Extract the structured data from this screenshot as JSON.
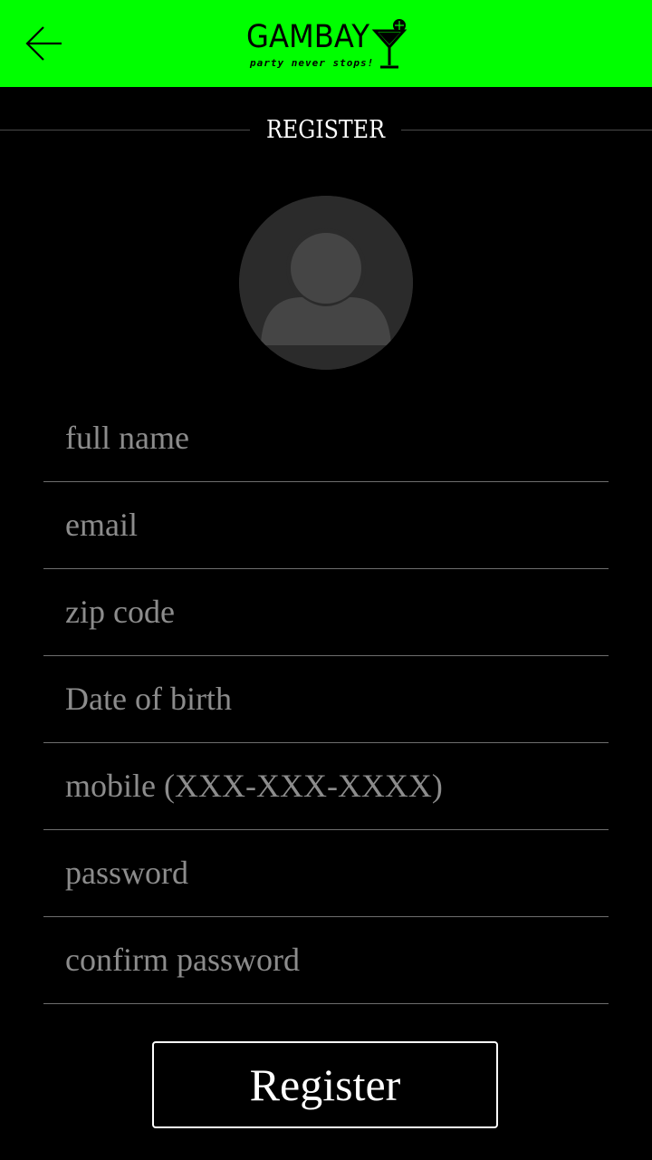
{
  "header": {
    "brand_color": "#00ff00",
    "back_icon": "arrow-left-icon",
    "logo": {
      "wordmark": "GAMBAY",
      "tagline": "party never stops!",
      "glass_icon": "cocktail-glass-icon"
    }
  },
  "page": {
    "section_title": "REGISTER"
  },
  "avatar": {
    "icon": "person-placeholder-icon"
  },
  "form": {
    "fields": [
      {
        "name": "full-name",
        "placeholder": "full name",
        "value": ""
      },
      {
        "name": "email",
        "placeholder": "email",
        "value": ""
      },
      {
        "name": "zip-code",
        "placeholder": "zip code",
        "value": ""
      },
      {
        "name": "date-of-birth",
        "placeholder": "Date of birth",
        "value": ""
      },
      {
        "name": "mobile",
        "placeholder": "mobile (XXX-XXX-XXXX)",
        "value": ""
      },
      {
        "name": "password",
        "placeholder": "password",
        "value": ""
      },
      {
        "name": "confirm-password",
        "placeholder": "confirm password",
        "value": ""
      }
    ],
    "submit_label": "Register"
  }
}
